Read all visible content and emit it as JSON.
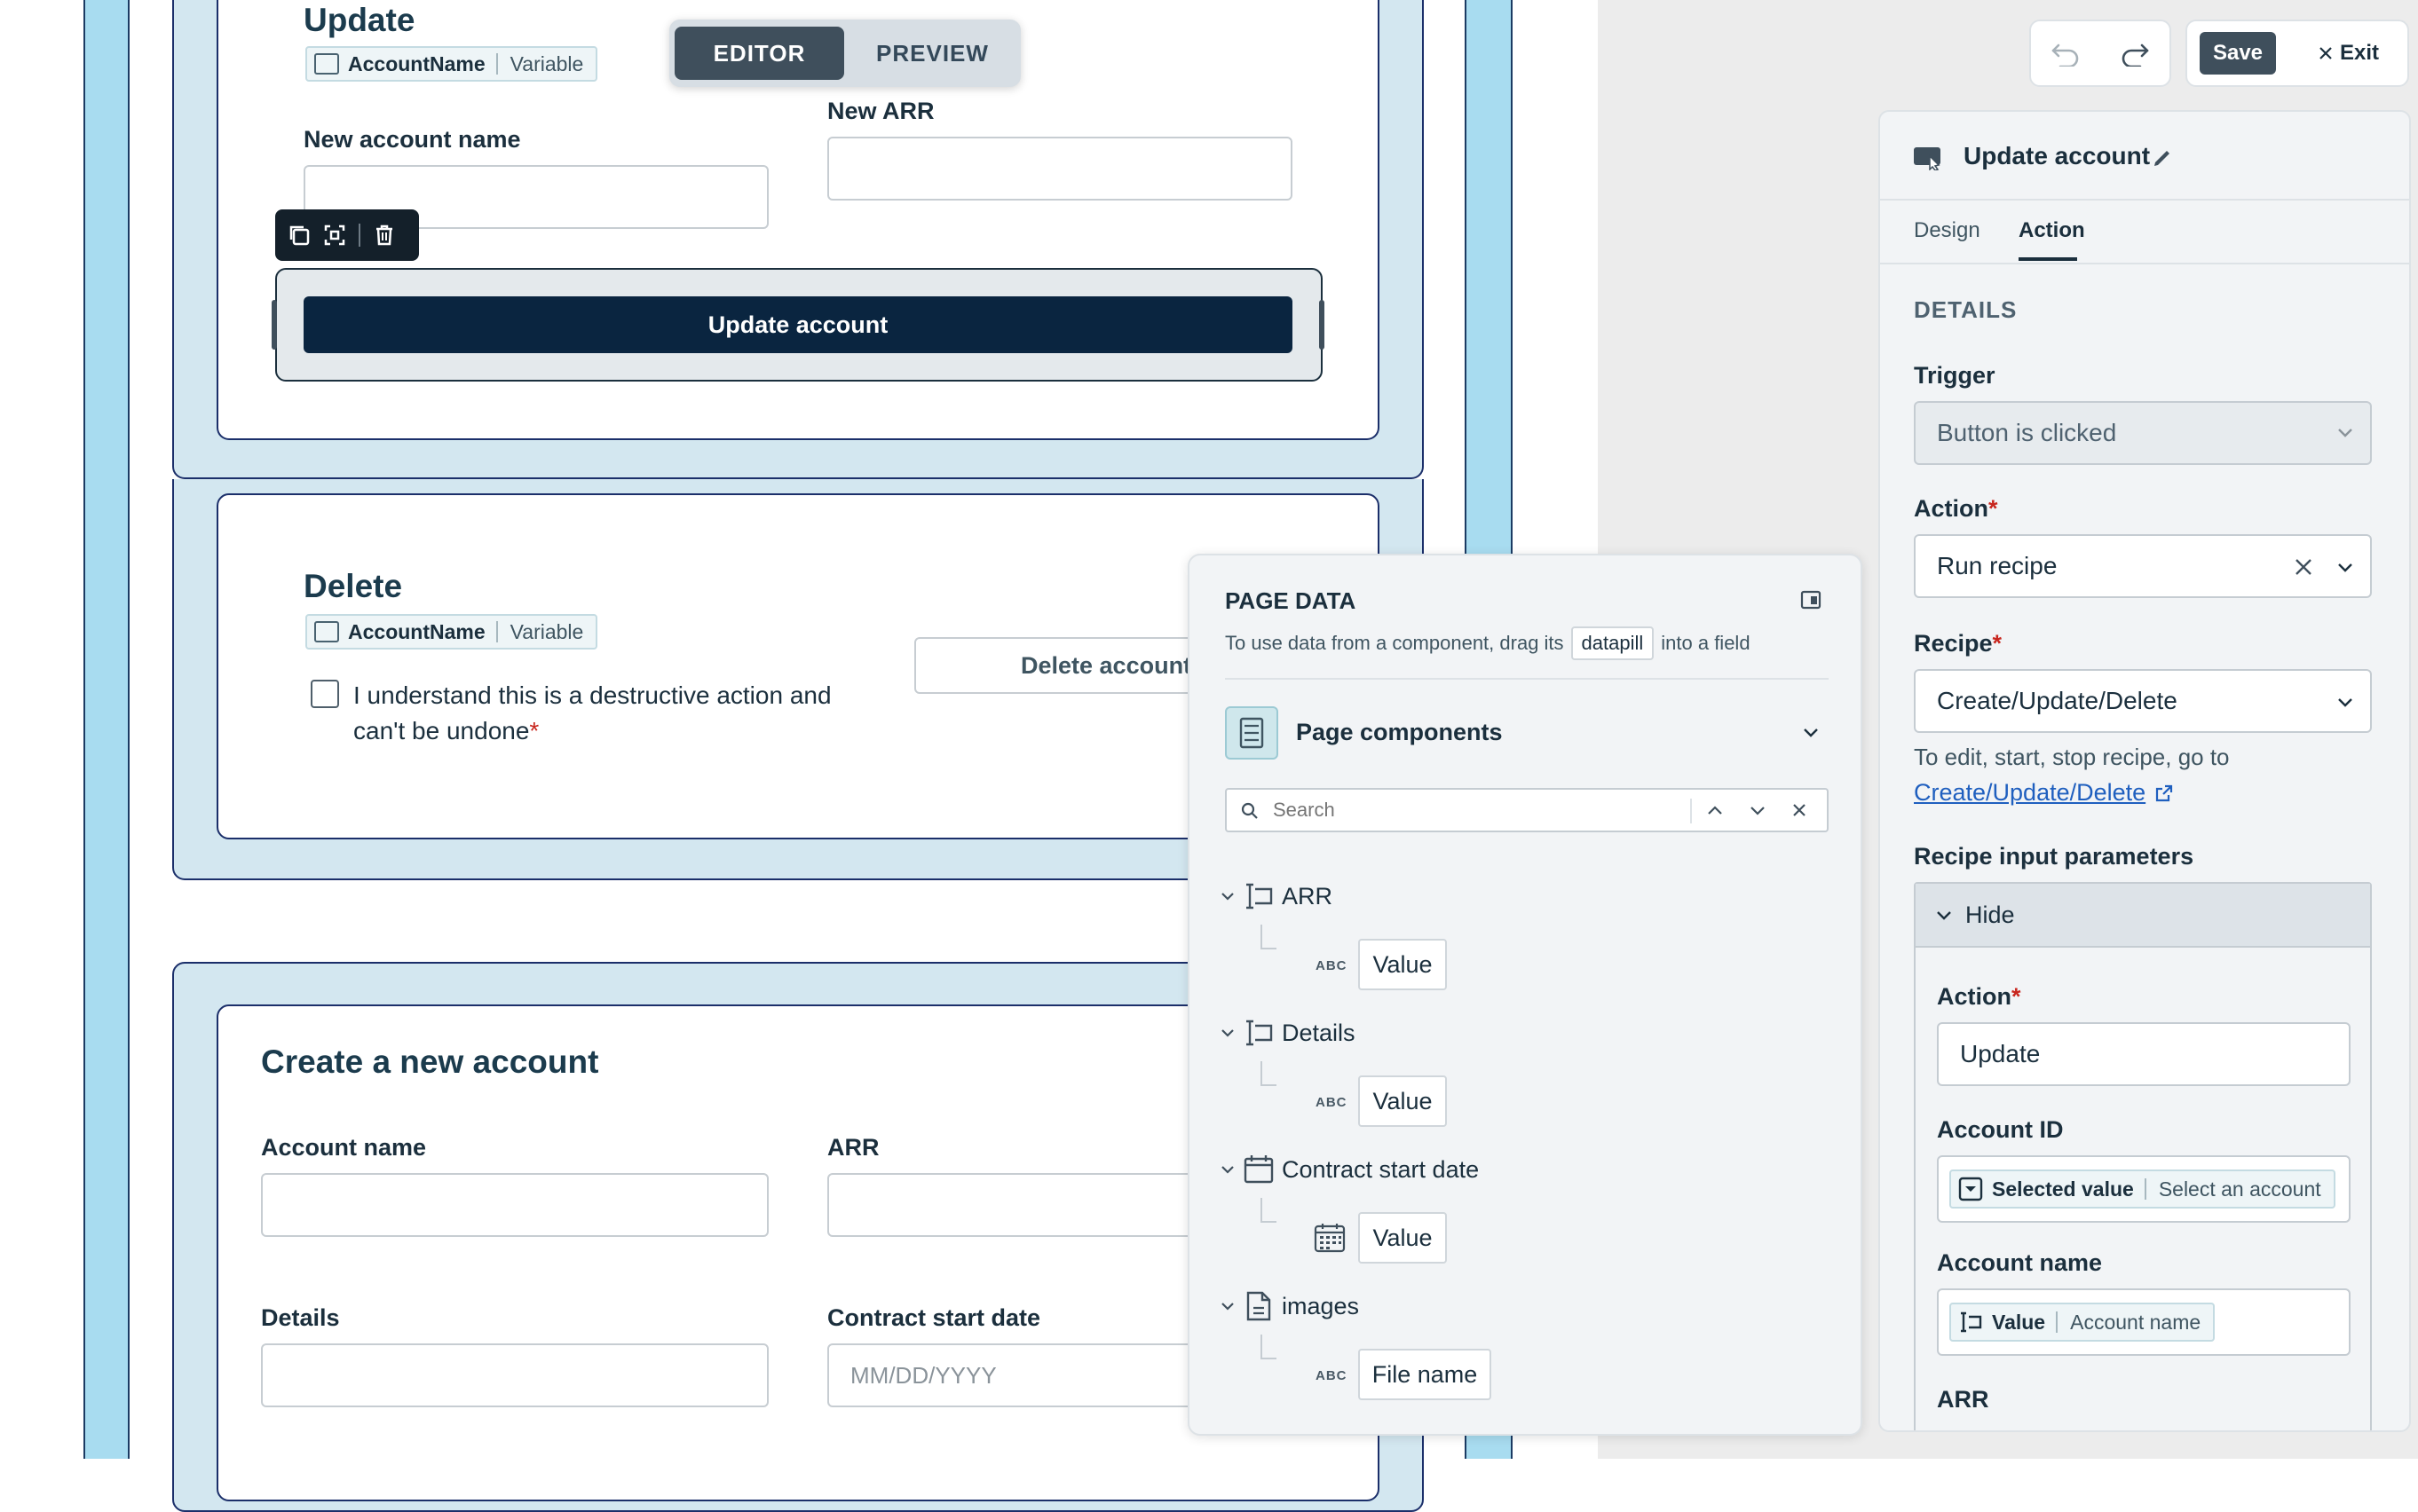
{
  "toggle": {
    "editor": "EDITOR",
    "preview": "PREVIEW"
  },
  "topbar": {
    "save": "Save",
    "exit": "Exit"
  },
  "update_section": {
    "heading": "Update",
    "pill_name": "AccountName",
    "pill_type": "Variable",
    "new_account_name_label": "New account name",
    "new_arr_label": "New ARR",
    "button": "Update account"
  },
  "delete_section": {
    "heading": "Delete",
    "pill_name": "AccountName",
    "pill_type": "Variable",
    "checkbox_line1": "I understand this is a destructive action and",
    "checkbox_line2": "can't be undone",
    "button": "Delete account"
  },
  "create_section": {
    "heading": "Create a new account",
    "account_name_label": "Account name",
    "arr_label": "ARR",
    "details_label": "Details",
    "contract_label": "Contract start date",
    "contract_placeholder": "MM/DD/YYYY"
  },
  "page_data": {
    "title": "PAGE DATA",
    "hint_before": "To use data from a component, drag its",
    "hint_pill": "datapill",
    "hint_after": "into a field",
    "components_label": "Page components",
    "search_placeholder": "Search",
    "items": [
      {
        "label": "ARR",
        "child": "Value",
        "child_type": "ABC"
      },
      {
        "label": "Details",
        "child": "Value",
        "child_type": "ABC"
      },
      {
        "label": "Contract start date",
        "child": "Value",
        "child_type": "calendar"
      },
      {
        "label": "images",
        "child": "File name",
        "child_type": "ABC"
      }
    ]
  },
  "right_panel": {
    "title": "Update account",
    "tabs": {
      "design": "Design",
      "action": "Action"
    },
    "details_heading": "DETAILS",
    "trigger_label": "Trigger",
    "trigger_value": "Button is clicked",
    "action_label": "Action",
    "action_value": "Run recipe",
    "recipe_label": "Recipe",
    "recipe_value": "Create/Update/Delete",
    "recipe_help": "To edit, start, stop recipe, go to",
    "recipe_link": "Create/Update/Delete",
    "params_label": "Recipe input parameters",
    "hide_label": "Hide",
    "param_action_label": "Action",
    "param_action_value": "Update",
    "account_id_label": "Account ID",
    "account_id_pill_name": "Selected value",
    "account_id_pill_type": "Select an account",
    "account_name_label": "Account name",
    "account_name_pill_name": "Value",
    "account_name_pill_type": "Account name",
    "arr_label": "ARR"
  },
  "colors": {
    "accent": "#0a2540",
    "link": "#1f5fbf",
    "stripe": "#a8dcf0",
    "section": "#d3e7f0",
    "required": "#c8261e"
  }
}
